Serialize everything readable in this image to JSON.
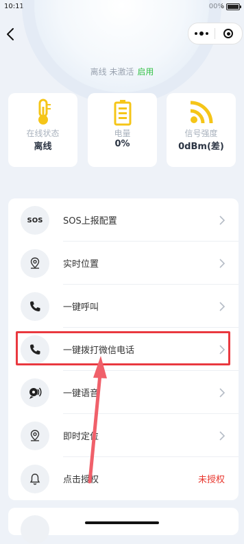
{
  "status_bar": {
    "time": "10:11",
    "battery": "100%"
  },
  "device": {
    "state": "离线 未激活",
    "enable_label": "启用"
  },
  "stats": [
    {
      "label": "在线状态",
      "value": "离线",
      "icon": "thermometer-icon"
    },
    {
      "label": "电量",
      "value": "0%",
      "icon": "battery-icon"
    },
    {
      "label": "信号强度",
      "value": "0dBm(差)",
      "icon": "signal-icon"
    }
  ],
  "menu": [
    {
      "label": "SOS上报配置",
      "icon": "sos-icon",
      "sos_text": "SOS"
    },
    {
      "label": "实时位置",
      "icon": "location-pin-icon"
    },
    {
      "label": "一键呼叫",
      "icon": "phone-icon"
    },
    {
      "label": "一键拨打微信电话",
      "icon": "phone-icon"
    },
    {
      "label": "一键语音",
      "icon": "voice-icon"
    },
    {
      "label": "即时定位",
      "icon": "location-pin-icon"
    },
    {
      "label": "点击授权",
      "icon": "bell-icon",
      "status": "未授权"
    }
  ],
  "colors": {
    "accent_yellow": "#f5c518",
    "enable_green": "#37c24a",
    "warning_red": "#e8362d",
    "highlight_red": "#e9383f"
  }
}
